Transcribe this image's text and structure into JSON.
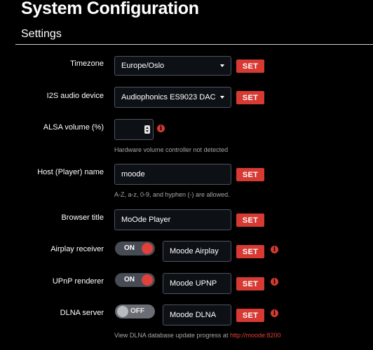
{
  "page": {
    "title": "System Configuration"
  },
  "section": {
    "title": "Settings"
  },
  "timezone": {
    "label": "Timezone",
    "value": "Europe/Oslo",
    "button": "SET"
  },
  "i2s": {
    "label": "I2S audio device",
    "value": "Audiophonics ES9023 DAC",
    "button": "SET"
  },
  "alsa": {
    "label": "ALSA volume (%)",
    "value": "",
    "help": "Hardware volume controller not detected",
    "info_icon": "info-icon"
  },
  "host": {
    "label": "Host (Player) name",
    "value": "moode",
    "button": "SET",
    "help": "A-Z, a-z, 0-9, and hyphen (-) are allowed."
  },
  "browser": {
    "label": "Browser title",
    "value": "MoOde Player",
    "button": "SET"
  },
  "airplay": {
    "label": "Airplay receiver",
    "toggle": "ON",
    "state": true,
    "name": "Moode Airplay",
    "button": "SET",
    "info_icon": "info-icon"
  },
  "upnp": {
    "label": "UPnP renderer",
    "toggle": "ON",
    "state": true,
    "name": "Moode UPNP",
    "button": "SET",
    "info_icon": "info-icon"
  },
  "dlna": {
    "label": "DLNA server",
    "toggle": "OFF",
    "state": false,
    "name": "Moode DLNA",
    "button": "SET",
    "info_icon": "info-icon",
    "help_prefix": "View DLNA database update progress at ",
    "help_link": "http://moode:8200"
  },
  "colors": {
    "accent": "#d63a33",
    "background": "#000000",
    "field_border": "#4a5560"
  }
}
